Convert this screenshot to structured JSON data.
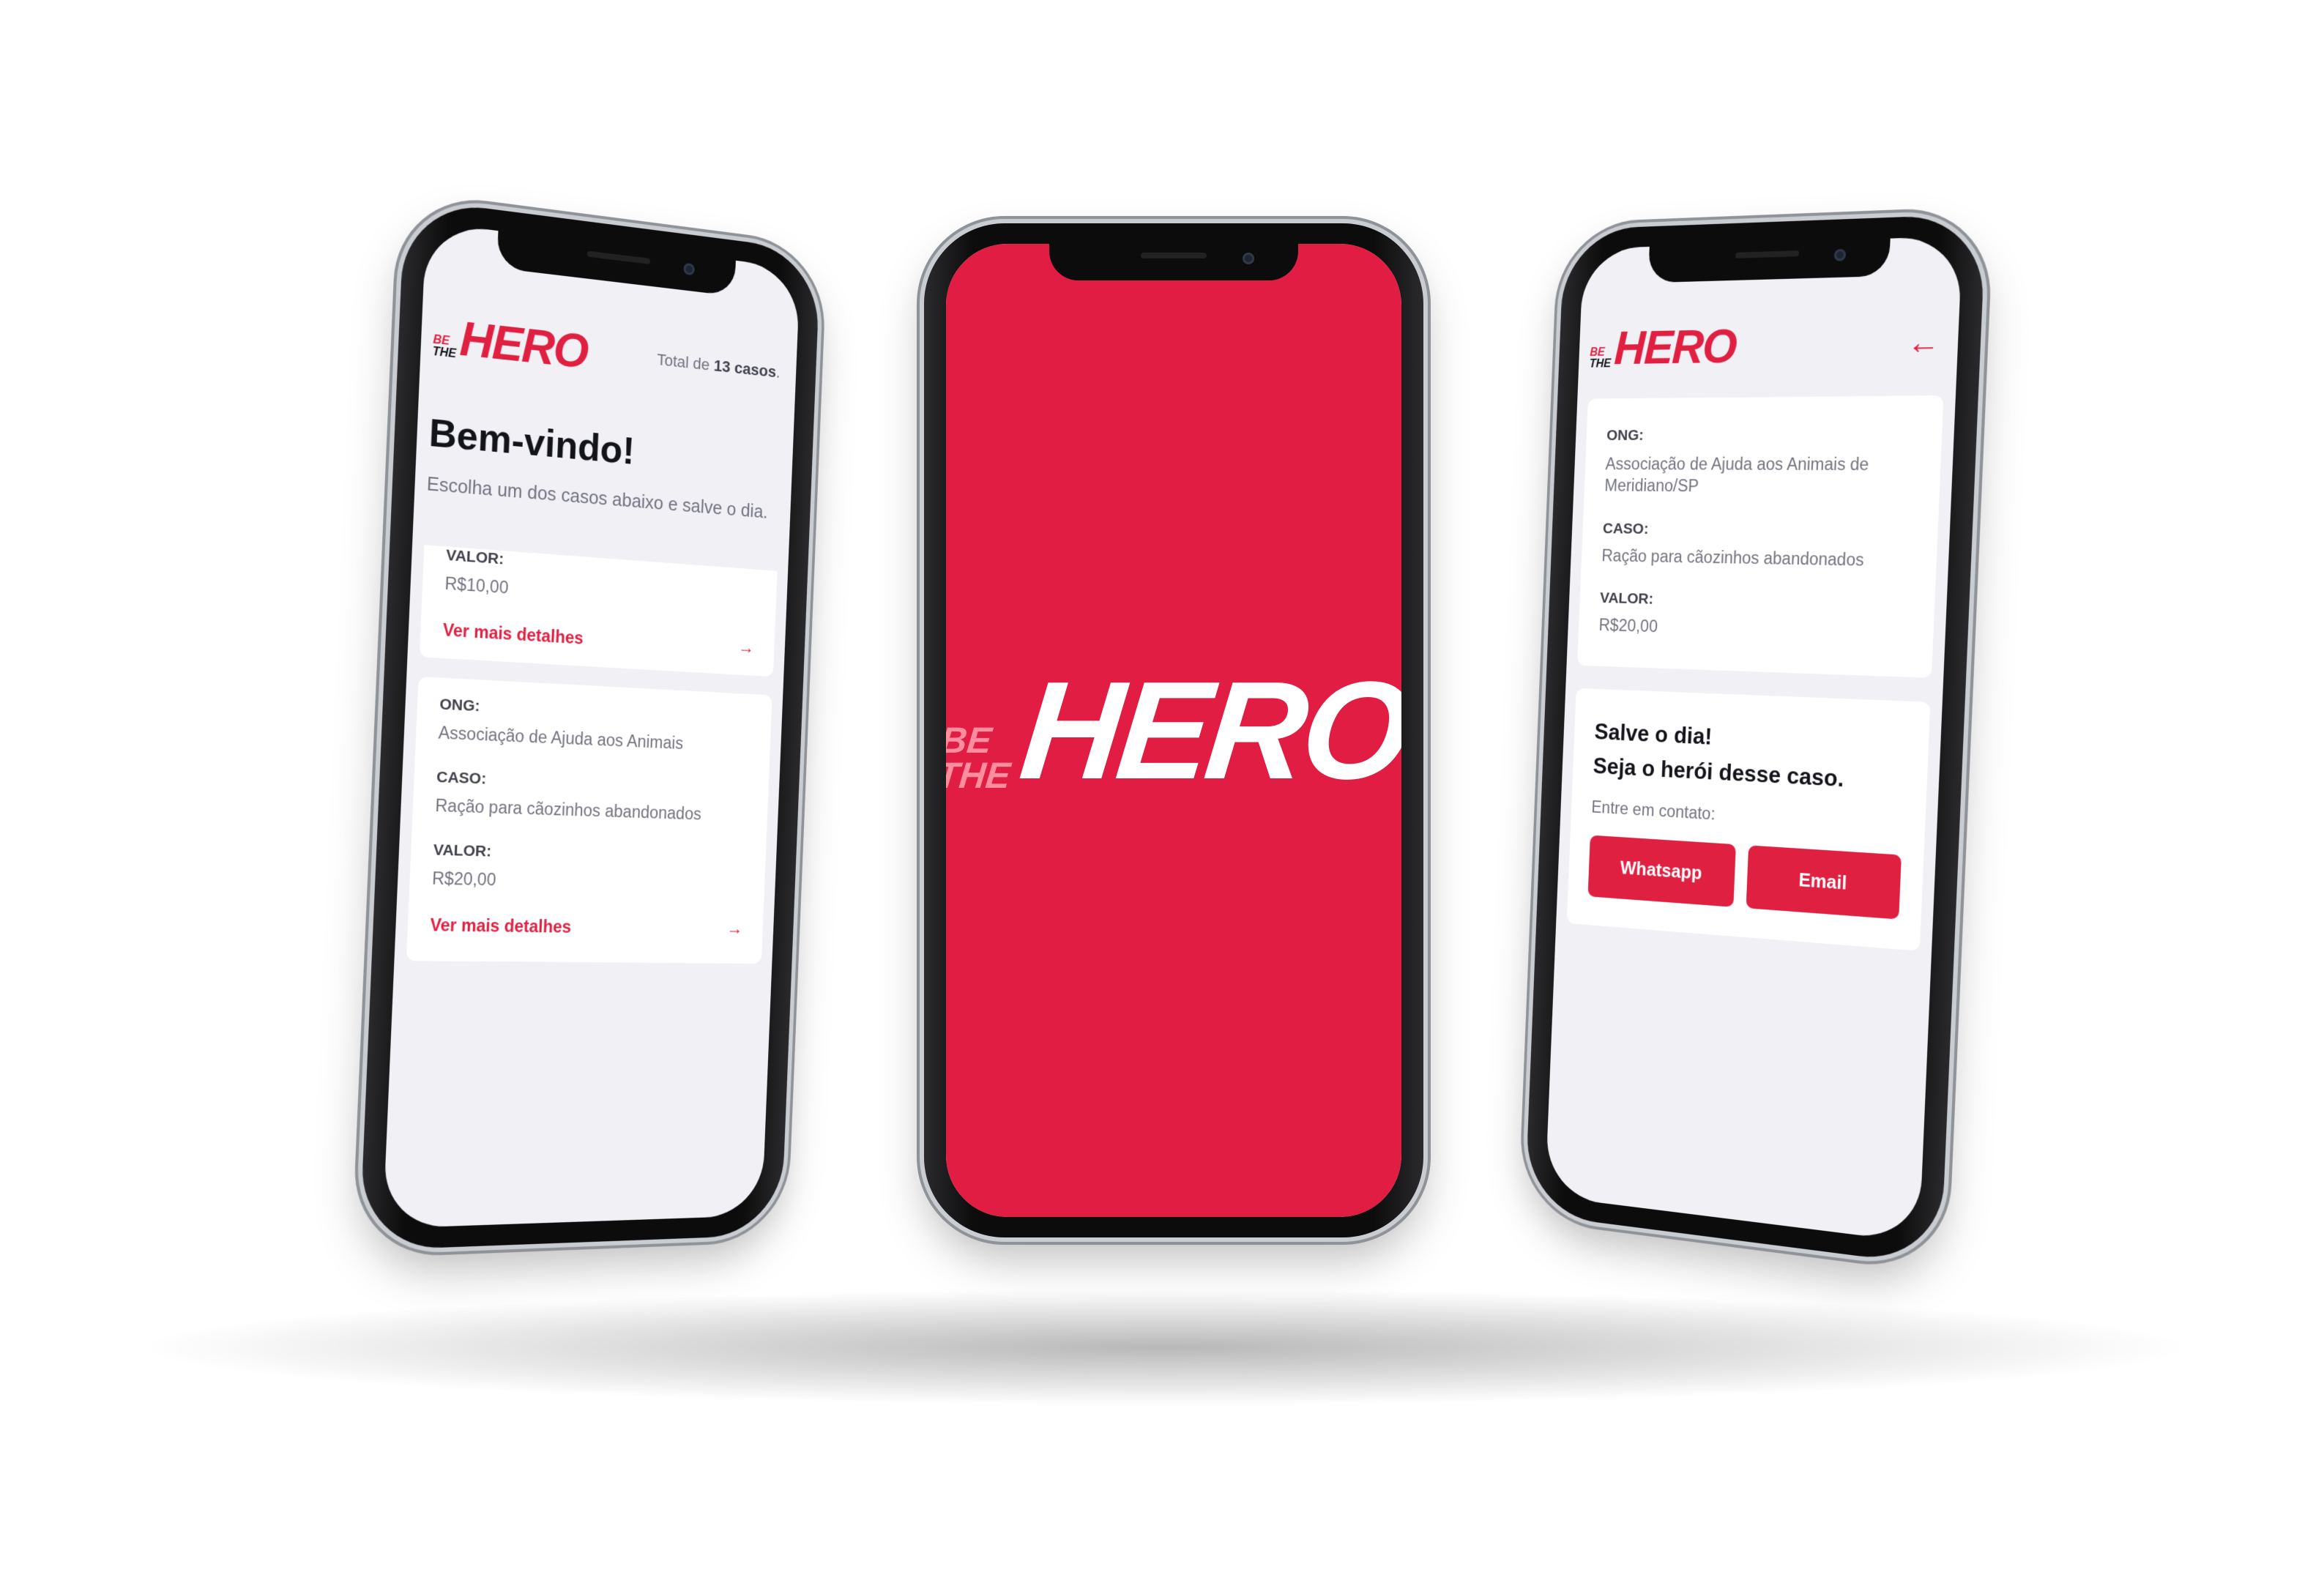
{
  "brand": {
    "logo_small_top": "BE",
    "logo_small_bottom": "THE",
    "logo_big": "HERO",
    "accent": "#e02041",
    "splash_bg": "#e11d43"
  },
  "list_screen": {
    "total_prefix": "Total de ",
    "total_count": "13 casos",
    "total_suffix": ".",
    "title": "Bem-vindo!",
    "description": "Escolha um dos casos abaixo e salve o dia.",
    "incidents": [
      {
        "valor_label": "VALOR:",
        "valor": "R$10,00",
        "details_label": "Ver mais detalhes"
      },
      {
        "ong_label": "ONG:",
        "ong": "Associação de Ajuda aos Animais",
        "caso_label": "CASO:",
        "caso": "Ração para cãozinhos abandonados",
        "valor_label": "VALOR:",
        "valor": "R$20,00",
        "details_label": "Ver mais detalhes"
      }
    ]
  },
  "detail_screen": {
    "back_icon": "arrow-left-icon",
    "ong_label": "ONG:",
    "ong": "Associação de Ajuda aos Animais de Meridiano/SP",
    "caso_label": "CASO:",
    "caso": "Ração para cãozinhos abandonados",
    "valor_label": "VALOR:",
    "valor": "R$20,00",
    "contact_title_1": "Salve o dia!",
    "contact_title_2": "Seja o herói desse caso.",
    "contact_subtitle": "Entre em contato:",
    "whatsapp_label": "Whatsapp",
    "email_label": "Email"
  }
}
